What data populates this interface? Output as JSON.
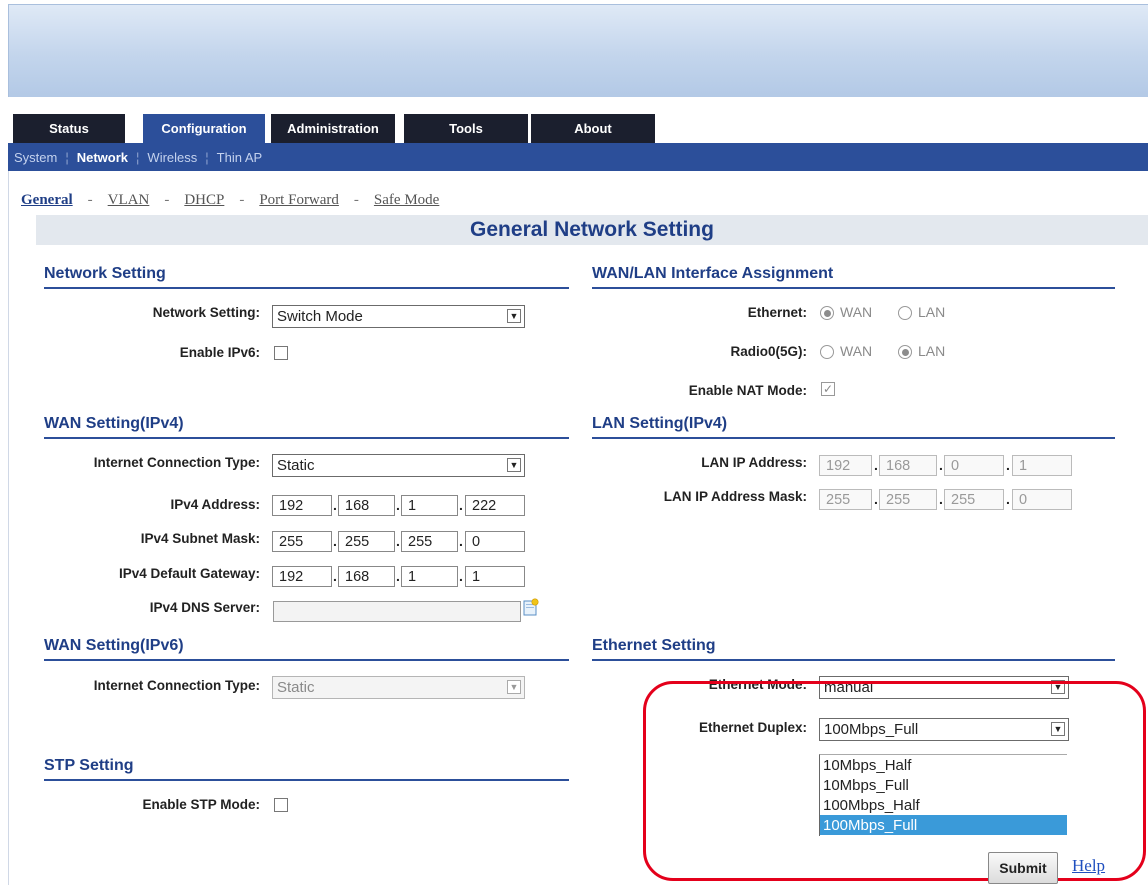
{
  "tabs": [
    "Status",
    "Configuration",
    "Administration",
    "Tools",
    "About"
  ],
  "subnav": [
    "System",
    "Network",
    "Wireless",
    "Thin AP"
  ],
  "pagetabs": [
    "General",
    "VLAN",
    "DHCP",
    "Port Forward",
    "Safe Mode"
  ],
  "page_title": "General Network Setting",
  "network": {
    "section": "Network Setting",
    "mode_label": "Network Setting:",
    "mode_value": "Switch Mode",
    "ipv6_label": "Enable IPv6:"
  },
  "wanlan": {
    "section": "WAN/LAN Interface Assignment",
    "ethernet_label": "Ethernet:",
    "radio_label": "Radio0(5G):",
    "wan": "WAN",
    "lan": "LAN",
    "nat_label": "Enable NAT Mode:"
  },
  "wan4": {
    "section": "WAN Setting(IPv4)",
    "conn_label": "Internet Connection Type:",
    "conn_value": "Static",
    "addr_label": "IPv4 Address:",
    "addr": [
      "192",
      "168",
      "1",
      "222"
    ],
    "mask_label": "IPv4 Subnet Mask:",
    "mask": [
      "255",
      "255",
      "255",
      "0"
    ],
    "gw_label": "IPv4 Default Gateway:",
    "gw": [
      "192",
      "168",
      "1",
      "1"
    ],
    "dns_label": "IPv4 DNS Server:"
  },
  "lan4": {
    "section": "LAN Setting(IPv4)",
    "ip_label": "LAN IP Address:",
    "ip": [
      "192",
      "168",
      "0",
      "1"
    ],
    "mask_label": "LAN IP Address Mask:",
    "mask": [
      "255",
      "255",
      "255",
      "0"
    ]
  },
  "wan6": {
    "section": "WAN Setting(IPv6)",
    "conn_label": "Internet Connection Type:",
    "conn_value": "Static"
  },
  "eth": {
    "section": "Ethernet Setting",
    "mode_label": "Ethernet Mode:",
    "mode_value": "manual",
    "duplex_label": "Ethernet Duplex:",
    "duplex_value": "100Mbps_Full",
    "options": [
      "10Mbps_Half",
      "10Mbps_Full",
      "100Mbps_Half",
      "100Mbps_Full"
    ]
  },
  "stp": {
    "section": "STP Setting",
    "label": "Enable STP Mode:"
  },
  "buttons": {
    "submit": "Submit",
    "help": "Help"
  },
  "colors": {
    "nav": "#2c4f9a",
    "highlight": "#e4001b",
    "selected_option": "#3a9ad9"
  }
}
